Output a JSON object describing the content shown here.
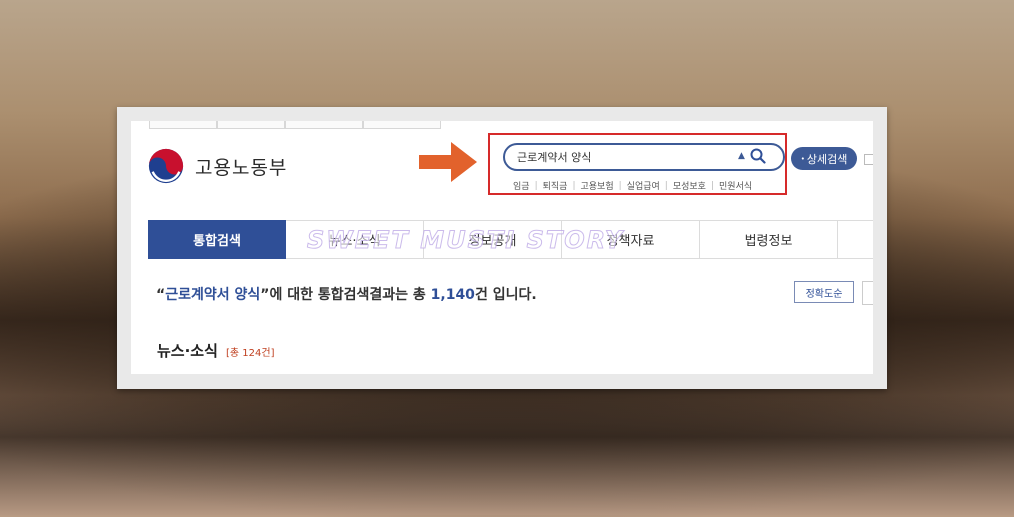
{
  "logo": {
    "text": "고용노동부"
  },
  "search": {
    "value": "근로계약서 양식",
    "caret": "▲"
  },
  "keywords": [
    "임금",
    "퇴직금",
    "고용보험",
    "실업급여",
    "모성보호",
    "민원서식"
  ],
  "advanced_search": {
    "bullet": "•",
    "label": "상세검색"
  },
  "nav": {
    "tabs": [
      {
        "label": "통합검색",
        "active": true
      },
      {
        "label": "뉴스·소식",
        "active": false
      },
      {
        "label": "정보공개",
        "active": false
      },
      {
        "label": "정책자료",
        "active": false
      },
      {
        "label": "법령정보",
        "active": false
      }
    ]
  },
  "watermark": {
    "text": "SWEET MUSTI STORY"
  },
  "result": {
    "open_quote": "“",
    "query": "근로계약서 양식",
    "middle": "”에 대한 통합검색결과는 총 ",
    "count": "1,140",
    "suffix": "건 입니다."
  },
  "sort": {
    "label": "정확도순"
  },
  "section": {
    "title": "뉴스·소식",
    "count": "[총 124건]"
  },
  "colors": {
    "accent": "#2f4f97",
    "highlight": "#d62a2a",
    "arrow": "#e2622c"
  }
}
